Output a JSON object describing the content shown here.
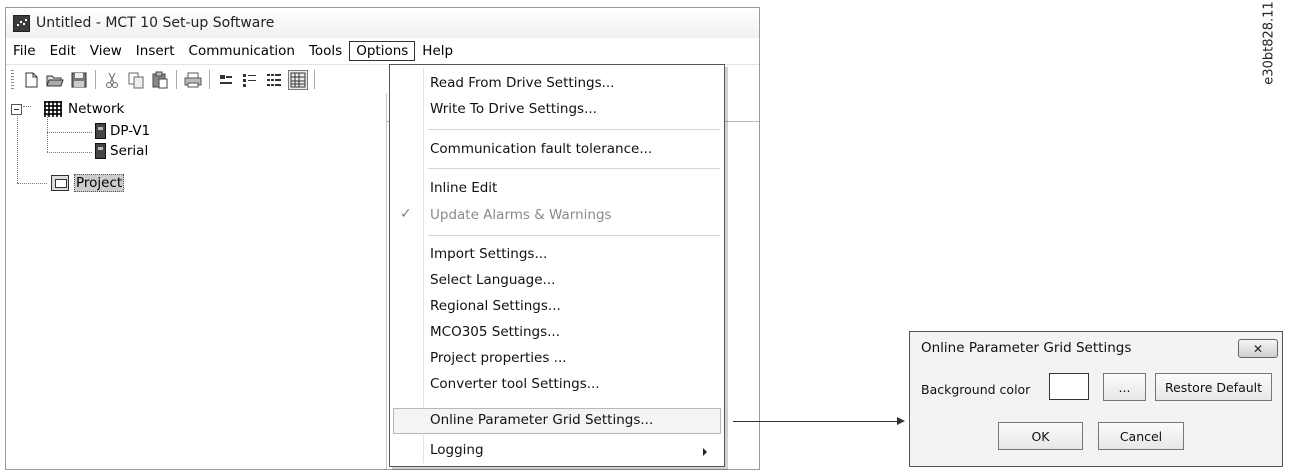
{
  "window": {
    "title": "Untitled - MCT 10 Set-up Software"
  },
  "menubar": {
    "items": [
      "File",
      "Edit",
      "View",
      "Insert",
      "Communication",
      "Tools",
      "Options",
      "Help"
    ],
    "active": "Options"
  },
  "toolbar": {
    "icons": [
      "new-file-icon",
      "open-folder-icon",
      "save-icon",
      "cut-icon",
      "copy-icon",
      "paste-icon",
      "print-icon",
      "large-icons-view-icon",
      "small-icons-view-icon",
      "list-view-icon",
      "details-view-icon"
    ]
  },
  "tree": {
    "network": "Network",
    "dpv1": "DP-V1",
    "serial": "Serial",
    "project": "Project"
  },
  "options_menu": {
    "items": [
      {
        "label": "Read From Drive Settings...",
        "enabled": true
      },
      {
        "label": "Write To Drive Settings...",
        "enabled": true
      },
      {
        "label": "Communication fault tolerance...",
        "enabled": true
      },
      {
        "label": "Inline Edit",
        "enabled": true
      },
      {
        "label": "Update Alarms & Warnings",
        "enabled": false,
        "checked": true
      },
      {
        "label": "Import Settings...",
        "enabled": true
      },
      {
        "label": "Select Language...",
        "enabled": true
      },
      {
        "label": "Regional Settings...",
        "enabled": true
      },
      {
        "label": "MCO305 Settings...",
        "enabled": true
      },
      {
        "label": "Project properties ...",
        "enabled": true
      },
      {
        "label": "Converter tool Settings...",
        "enabled": true
      },
      {
        "label": "Online Parameter Grid Settings...",
        "enabled": true,
        "highlighted": true
      },
      {
        "label": "Logging",
        "enabled": true,
        "submenu": true
      }
    ],
    "checkmark": "✓"
  },
  "dialog": {
    "title": "Online Parameter Grid Settings",
    "close_label": "✕",
    "background_color_label": "Background color",
    "background_color_value": "#ffffff",
    "browse_label": "...",
    "restore_label": "Restore Default",
    "ok_label": "OK",
    "cancel_label": "Cancel"
  },
  "figure_id": "e30bt828.11"
}
